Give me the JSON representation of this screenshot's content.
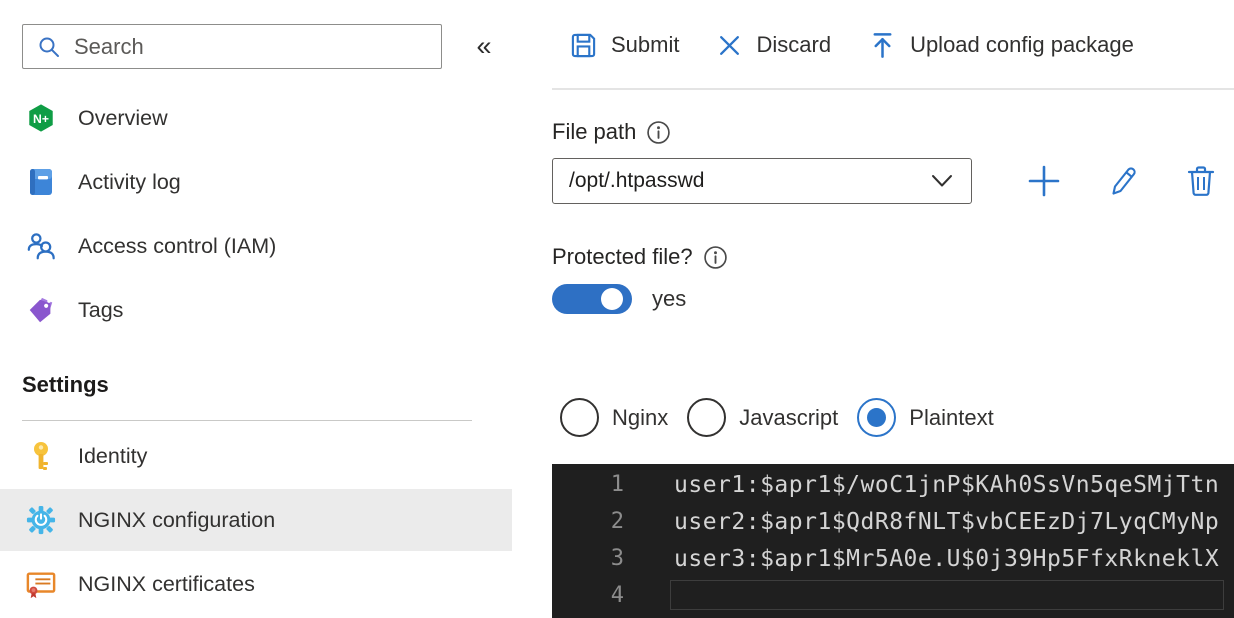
{
  "sidebar": {
    "search": {
      "placeholder": "Search"
    },
    "collapse_glyph": "«",
    "items": [
      {
        "label": "Overview",
        "icon": "nginx-logo-icon"
      },
      {
        "label": "Activity log",
        "icon": "activity-log-icon"
      },
      {
        "label": "Access control (IAM)",
        "icon": "access-control-icon"
      },
      {
        "label": "Tags",
        "icon": "tags-icon"
      }
    ],
    "settings_header": "Settings",
    "settings_items": [
      {
        "label": "Identity",
        "icon": "key-icon",
        "selected": false
      },
      {
        "label": "NGINX configuration",
        "icon": "gear-icon",
        "selected": true
      },
      {
        "label": "NGINX certificates",
        "icon": "certificate-icon",
        "selected": false
      }
    ]
  },
  "toolbar": {
    "submit_label": "Submit",
    "discard_label": "Discard",
    "upload_label": "Upload config package"
  },
  "form": {
    "file_path_label": "File path",
    "file_path_value": "/opt/.htpasswd",
    "protected_label": "Protected file?",
    "protected_value": "yes",
    "protected_on": true
  },
  "editor_modes": [
    {
      "label": "Nginx",
      "selected": false
    },
    {
      "label": "Javascript",
      "selected": false
    },
    {
      "label": "Plaintext",
      "selected": true
    }
  ],
  "editor": {
    "lines": [
      {
        "number": "1",
        "text": "user1:$apr1$/woC1jnP$KAh0SsVn5qeSMjTtn"
      },
      {
        "number": "2",
        "text": "user2:$apr1$QdR8fNLT$vbCEEzDj7LyqCMyNp"
      },
      {
        "number": "3",
        "text": "user3:$apr1$Mr5A0e.U$0j39Hp5FfxRkneklX"
      },
      {
        "number": "4",
        "text": ""
      }
    ]
  },
  "colors": {
    "accent_blue": "#2b74c9",
    "toggle_blue": "#2e70c4",
    "editor_background": "#1f1f1f",
    "selected_item_background": "#ebebeb",
    "nginx_green": "#0f9d45"
  }
}
